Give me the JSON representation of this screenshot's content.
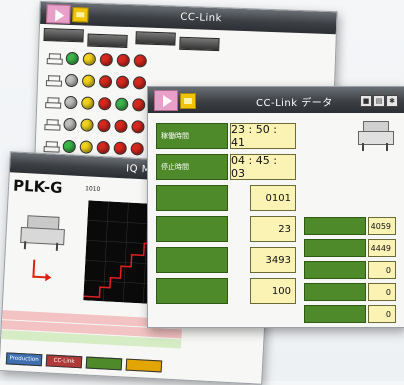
{
  "colors": {
    "accent_green": "#4e8a2a",
    "value_yellow": "#fbf3b4",
    "pink_button": "#e8a0c8",
    "yellow_button": "#f2c400",
    "arrow_blue": "#5b6b80"
  },
  "cc_link_panel": {
    "title": "CC-Link",
    "tabs": [
      "",
      "",
      "",
      ""
    ],
    "lamp_rows": [
      [
        "green",
        "yellow",
        "red",
        "red",
        "red"
      ],
      [
        "gray",
        "yellow",
        "red",
        "red",
        "red"
      ],
      [
        "gray",
        "yellow",
        "red",
        "green",
        "red"
      ],
      [
        "gray",
        "yellow",
        "red",
        "red",
        "red"
      ],
      [
        "green",
        "yellow",
        "red",
        "red",
        "red"
      ],
      [
        "gray",
        "yellow",
        "red",
        "red",
        "red"
      ],
      [
        "gray",
        "yellow",
        "red",
        "red",
        "red"
      ]
    ]
  },
  "data_panel": {
    "title": "CC-Link データ",
    "left_rows": [
      {
        "label": "稼働時間",
        "value": "23 : 50 : 41"
      },
      {
        "label": "停止時間",
        "value": "04 : 45 : 03"
      },
      {
        "label": "",
        "value": "0101"
      },
      {
        "label": "",
        "value": "23"
      },
      {
        "label": "",
        "value": "3493"
      },
      {
        "label": "",
        "value": "100"
      }
    ],
    "right_rows": [
      {
        "label": "",
        "value": "4059"
      },
      {
        "label": "",
        "value": "4449"
      },
      {
        "label": "",
        "value": "0"
      },
      {
        "label": "",
        "value": "0"
      },
      {
        "label": "",
        "value": "0"
      }
    ]
  },
  "monitor_panel": {
    "title": "IQ Monitor",
    "model": "PLK-G",
    "sub_label": "1010",
    "legend": [
      "",
      "",
      ""
    ],
    "footer_buttons": [
      {
        "label": "Production",
        "color": "#3f6fb0"
      },
      {
        "label": "CC-Link",
        "color": "#b03a3a"
      },
      {
        "label": "",
        "color": "#4e8a2a"
      },
      {
        "label": "",
        "color": "#e3a500"
      }
    ]
  }
}
